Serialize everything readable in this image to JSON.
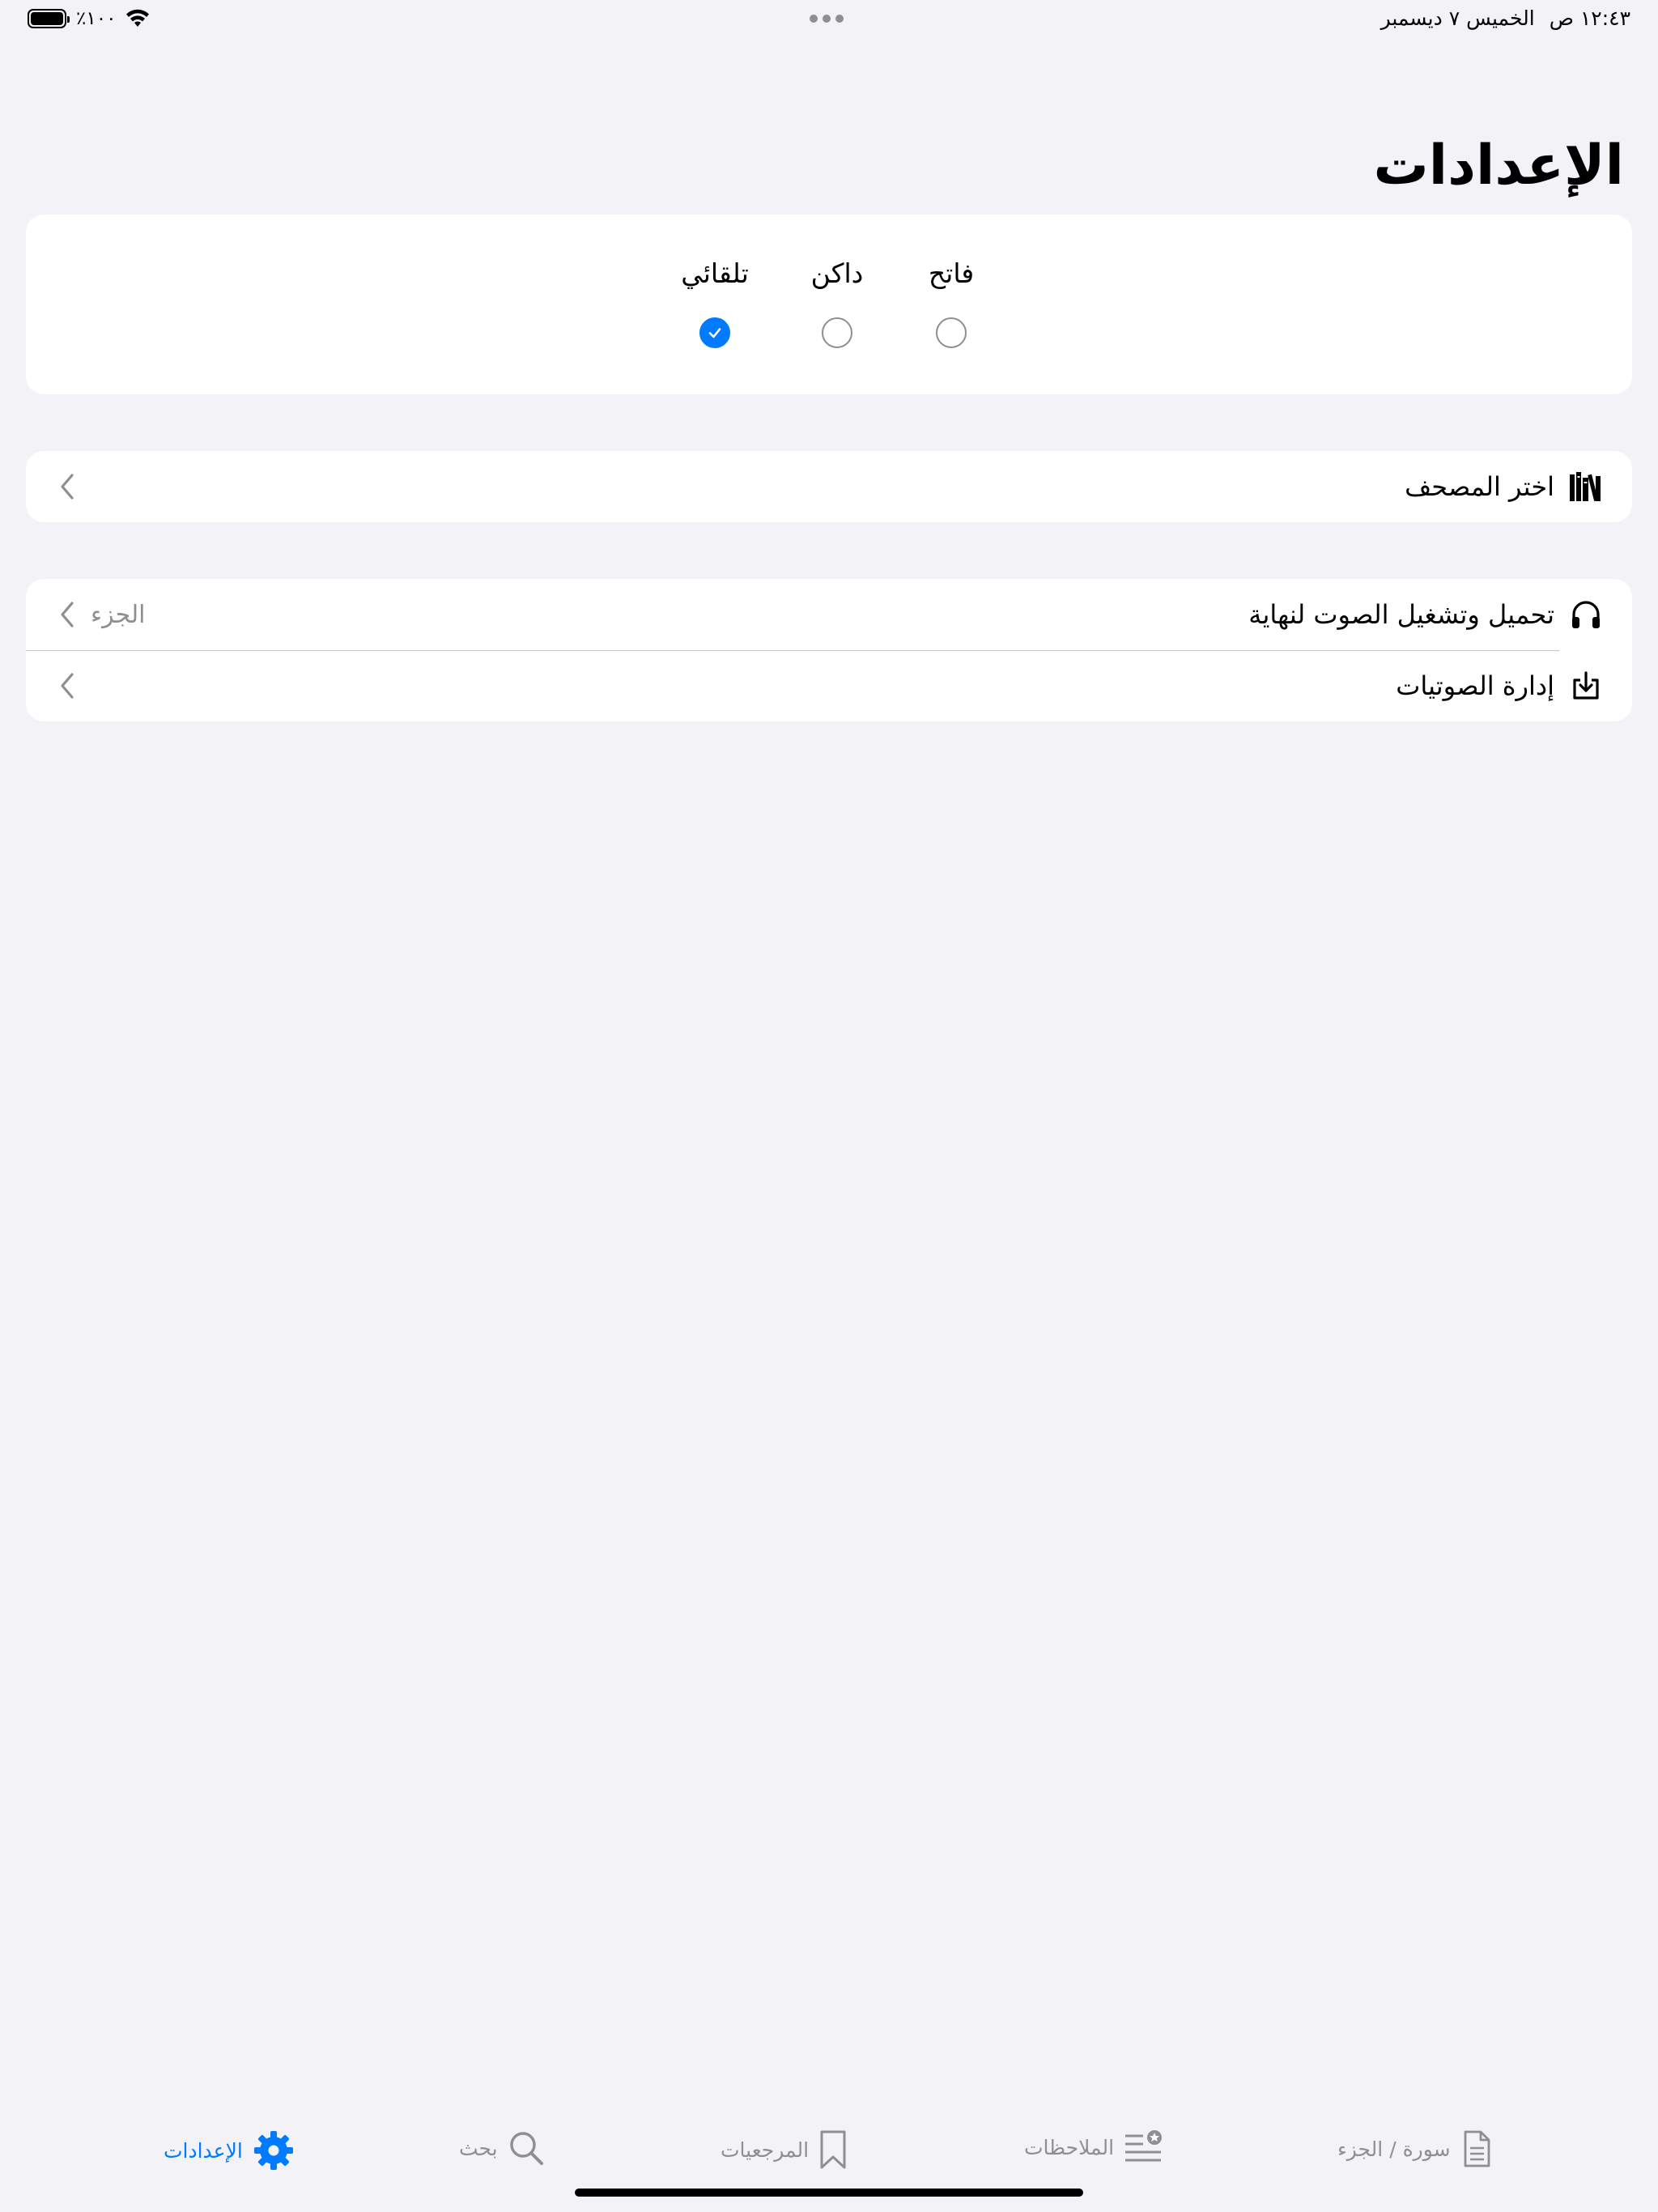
{
  "status_bar": {
    "time": "١٢:٤٣ ص",
    "date": "الخميس ٧ ديسمبر",
    "battery": "٪١٠٠"
  },
  "title": "الإعدادات",
  "theme": {
    "options": [
      {
        "label": "فاتح",
        "checked": false
      },
      {
        "label": "داكن",
        "checked": false
      },
      {
        "label": "تلقائي",
        "checked": true
      }
    ]
  },
  "mushaf_row": {
    "label": "اختر المصحف",
    "icon": "books-icon"
  },
  "audio_rows": [
    {
      "label": "تحميل وتشغيل الصوت لنهاية",
      "detail": "الجزء",
      "icon": "headphones-icon"
    },
    {
      "label": "إدارة الصوتيات",
      "detail": "",
      "icon": "download-tray-icon"
    }
  ],
  "tabs": [
    {
      "label": "سورة / الجزء",
      "icon": "document-icon",
      "active": false
    },
    {
      "label": "الملاحظات",
      "icon": "starred-list-icon",
      "active": false
    },
    {
      "label": "المرجعيات",
      "icon": "bookmark-icon",
      "active": false
    },
    {
      "label": "بحث",
      "icon": "search-icon",
      "active": false
    },
    {
      "label": "الإعدادات",
      "icon": "gear-icon",
      "active": true
    }
  ],
  "colors": {
    "accent": "#007aff",
    "background": "#f2f2f7",
    "secondary": "#8e8e93"
  }
}
